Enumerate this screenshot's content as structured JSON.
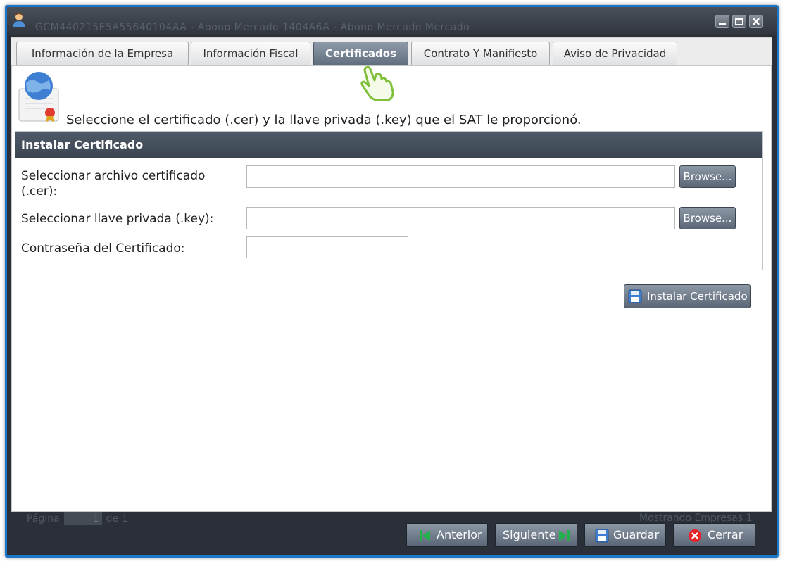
{
  "window": {
    "ghost_title": "GCM440215E5A55640104AA - Abono Mercado 1404A6A - Abono Mercado Mercado",
    "buttons": {
      "minimize": "minimize",
      "maximize": "maximize",
      "close": "close"
    }
  },
  "tabs": [
    {
      "label": "Información de la Empresa",
      "active": false
    },
    {
      "label": "Información Fiscal",
      "active": false
    },
    {
      "label": "Certificados",
      "active": true
    },
    {
      "label": "Contrato Y Manifiesto",
      "active": false
    },
    {
      "label": "Aviso de Privacidad",
      "active": false
    }
  ],
  "content": {
    "instruction": "Seleccione el certificado (.cer) y la llave privada (.key) que el SAT le proporcionó.",
    "section_title": "Instalar Certificado",
    "cert_label_line1": "Seleccionar archivo certificado",
    "cert_label_line2": "(.cer):",
    "cert_value": "",
    "key_label": "Seleccionar llave privada (.key):",
    "key_value": "",
    "password_label": "Contraseña del Certificado:",
    "password_value": "",
    "browse_label": "Browse...",
    "install_label": "Instalar Certificado"
  },
  "background": {
    "pager_prefix": "Página",
    "pager_value": "1",
    "pager_suffix": "de 1",
    "status": "Mostrando Empresas 1"
  },
  "footer": {
    "prev": "Anterior",
    "next": "Siguiente",
    "save": "Guardar",
    "close": "Cerrar"
  },
  "colors": {
    "frame_border": "#1b78c9",
    "active_tab": "#6e7b8b",
    "header_bar": "#434d5a",
    "prev_next_icon": "#22b14c",
    "close_icon": "#e8242a"
  }
}
